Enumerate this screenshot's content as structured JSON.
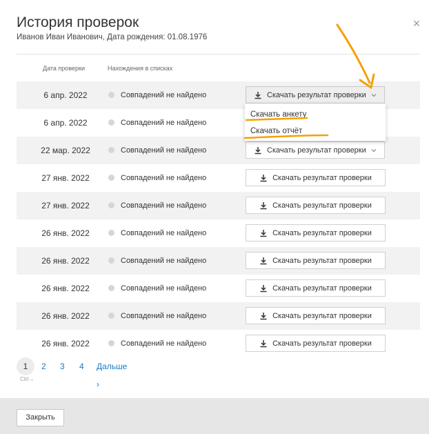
{
  "dialog": {
    "title": "История проверок",
    "subtitle": "Иванов Иван Иванович, Дата рождения: 01.08.1976",
    "close_icon": "close-icon"
  },
  "table": {
    "headers": {
      "date": "Дата проверки",
      "lists": "Нахождения в списках"
    },
    "rows": [
      {
        "date": "6 апр. 2022",
        "status": "Совпадений не найдено",
        "action": "Скачать результат проверки",
        "dropdown": true,
        "open": true,
        "shaded": true
      },
      {
        "date": "6 апр. 2022",
        "status": "Совпадений не найдено",
        "action": "",
        "dropdown": false,
        "open": false,
        "shaded": false
      },
      {
        "date": "22 мар. 2022",
        "status": "Совпадений не найдено",
        "action": "Скачать результат проверки",
        "dropdown": true,
        "open": false,
        "shaded": true
      },
      {
        "date": "27 янв. 2022",
        "status": "Совпадений не найдено",
        "action": "Скачать результат проверки",
        "dropdown": false,
        "open": false,
        "shaded": false
      },
      {
        "date": "27 янв. 2022",
        "status": "Совпадений не найдено",
        "action": "Скачать результат проверки",
        "dropdown": false,
        "open": false,
        "shaded": true
      },
      {
        "date": "26 янв. 2022",
        "status": "Совпадений не найдено",
        "action": "Скачать результат проверки",
        "dropdown": false,
        "open": false,
        "shaded": false
      },
      {
        "date": "26 янв. 2022",
        "status": "Совпадений не найдено",
        "action": "Скачать результат проверки",
        "dropdown": false,
        "open": false,
        "shaded": true
      },
      {
        "date": "26 янв. 2022",
        "status": "Совпадений не найдено",
        "action": "Скачать результат проверки",
        "dropdown": false,
        "open": false,
        "shaded": false
      },
      {
        "date": "26 янв. 2022",
        "status": "Совпадений не найдено",
        "action": "Скачать результат проверки",
        "dropdown": false,
        "open": false,
        "shaded": true
      },
      {
        "date": "26 янв. 2022",
        "status": "Совпадений не найдено",
        "action": "Скачать результат проверки",
        "dropdown": false,
        "open": false,
        "shaded": false
      }
    ]
  },
  "dropdown_menu": {
    "items": [
      "Скачать анкету",
      "Скачать отчёт"
    ]
  },
  "pagination": {
    "current": "1",
    "pages": [
      "2",
      "3",
      "4"
    ],
    "next": "Дальше",
    "hint": "Ctrl→"
  },
  "footer": {
    "close_label": "Закрыть"
  },
  "colors": {
    "link": "#1a7ac0",
    "annotation": "#f5a000",
    "row_shade": "#f2f2f2"
  }
}
